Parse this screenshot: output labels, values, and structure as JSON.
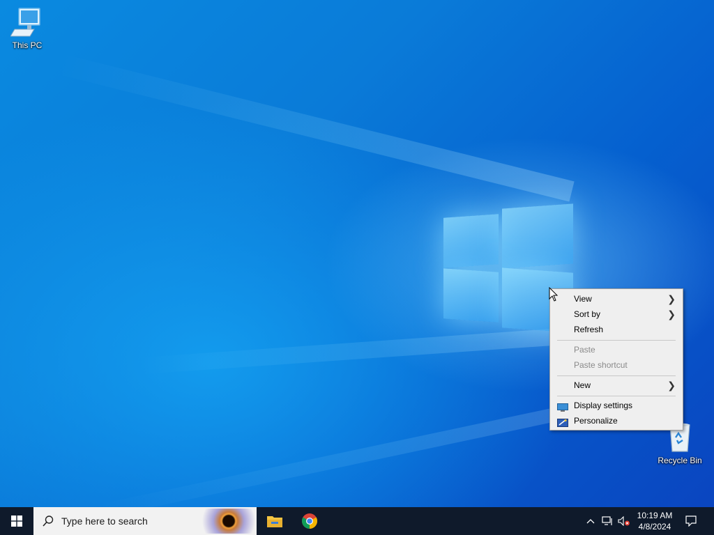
{
  "desktop": {
    "icons": [
      {
        "label": "This PC",
        "icon": "this-pc-icon"
      },
      {
        "label": "Recycle Bin",
        "icon": "recycle-bin-icon"
      }
    ]
  },
  "context_menu": {
    "items": [
      {
        "label": "View",
        "has_submenu": true,
        "enabled": true
      },
      {
        "label": "Sort by",
        "has_submenu": true,
        "enabled": true
      },
      {
        "label": "Refresh",
        "has_submenu": false,
        "enabled": true
      },
      {
        "label": "Paste",
        "has_submenu": false,
        "enabled": false
      },
      {
        "label": "Paste shortcut",
        "has_submenu": false,
        "enabled": false
      },
      {
        "label": "New",
        "has_submenu": true,
        "enabled": true
      },
      {
        "label": "Display settings",
        "icon": "display-settings-icon",
        "enabled": true
      },
      {
        "label": "Personalize",
        "icon": "personalize-icon",
        "enabled": true
      }
    ]
  },
  "taskbar": {
    "search_placeholder": "Type here to search",
    "apps": [
      {
        "name": "File Explorer",
        "icon": "file-explorer-icon"
      },
      {
        "name": "Google Chrome",
        "icon": "chrome-icon"
      }
    ],
    "tray": {
      "time": "10:19 AM",
      "date": "4/8/2024"
    }
  },
  "colors": {
    "taskbar_bg": "#0f1a2b",
    "desktop_blue": "#0a7bd8",
    "menu_bg": "#efefef"
  }
}
